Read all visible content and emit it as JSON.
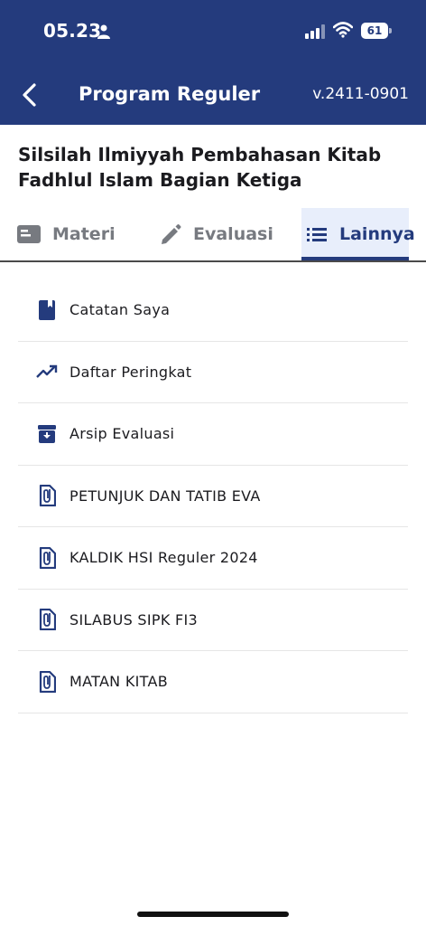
{
  "status_bar": {
    "time": "05.23",
    "battery": "61"
  },
  "header": {
    "title": "Program Reguler",
    "version": "v.2411-0901"
  },
  "course_title": "Silsilah Ilmiyyah Pembahasan Kitab Fadhlul Islam Bagian Ketiga",
  "tabs": [
    {
      "label": "Materi",
      "icon": "book-icon"
    },
    {
      "label": "Evaluasi",
      "icon": "pencil-icon"
    },
    {
      "label": "Lainnya",
      "icon": "list-icon",
      "active": true
    }
  ],
  "menu": [
    {
      "label": "Catatan Saya",
      "icon": "bookmark-book-icon"
    },
    {
      "label": "Daftar Peringkat",
      "icon": "trending-up-icon"
    },
    {
      "label": "Arsip Evaluasi",
      "icon": "archive-icon"
    },
    {
      "label": "PETUNJUK DAN TATIB EVA",
      "icon": "paperclip-document-icon"
    },
    {
      "label": "KALDIK HSI Reguler 2024",
      "icon": "paperclip-document-icon"
    },
    {
      "label": "SILABUS SIPK FI3",
      "icon": "paperclip-document-icon"
    },
    {
      "label": "MATAN KITAB",
      "icon": "paperclip-document-icon"
    }
  ],
  "colors": {
    "primary": "#243b7d",
    "tab_inactive": "#777a80",
    "active_tab_bg": "#e8eefb"
  }
}
